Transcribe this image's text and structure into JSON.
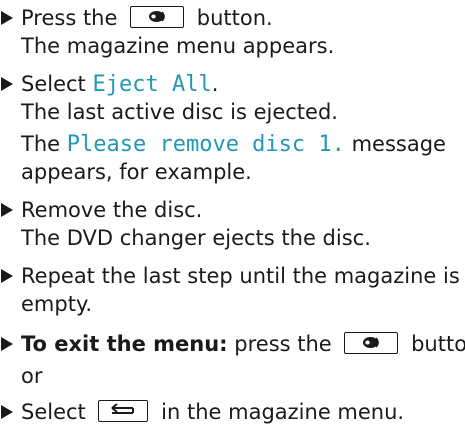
{
  "steps": [
    {
      "before": "Press the",
      "after": "button.",
      "result": "The magazine menu appears."
    },
    {
      "before": "Select",
      "code": "Eject All",
      "after": ".",
      "result": "The last active disc is ejected."
    },
    {
      "msg_before": "The",
      "msg_code": "Please remove disc 1.",
      "msg_after": "message",
      "msg_cont": "appears, for example."
    },
    {
      "text": "Remove the disc.",
      "result": "The DVD changer ejects the disc."
    },
    {
      "text": "Repeat the last step until the magazine is",
      "cont": "empty."
    },
    {
      "bold": "To exit the menu:",
      "before": "press the",
      "after": "button."
    },
    {
      "text": "or"
    },
    {
      "before": "Select",
      "after": "in the magazine menu."
    }
  ],
  "icons": {
    "disc_button": "disc-magazine-icon",
    "back_button": "back-arrow-icon"
  },
  "colors": {
    "code_text": "#2596b8",
    "body_text": "#1a1a1a"
  }
}
